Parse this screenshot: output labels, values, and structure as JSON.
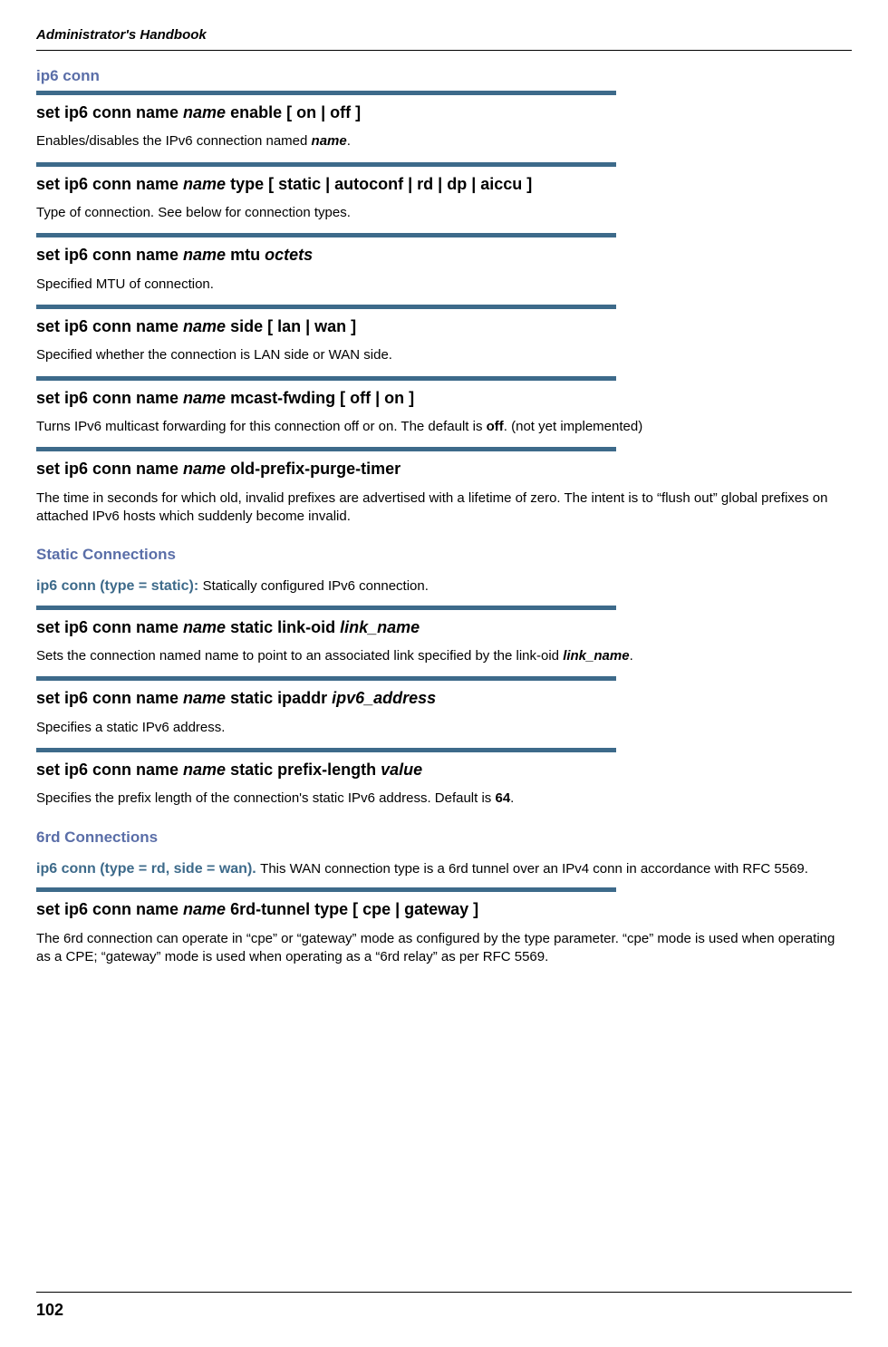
{
  "header": "Administrator's Handbook",
  "page_number": "102",
  "section1_label": "ip6 conn",
  "entries": [
    {
      "cmd_pre": "set ip6 conn name ",
      "cmd_ital": "name",
      "cmd_post": " enable [ on | off ]",
      "desc_pre": "Enables/disables the IPv6 connection named ",
      "desc_bi": "name",
      "desc_post": "."
    },
    {
      "cmd_pre": "set ip6 conn name ",
      "cmd_ital": "name",
      "cmd_post": " type [ static | autoconf | rd | dp | aiccu ]",
      "desc_pre": "Type of connection. See below for connection types.",
      "desc_bi": "",
      "desc_post": ""
    },
    {
      "cmd_pre": "set ip6 conn name ",
      "cmd_ital": "name",
      "cmd_mid": " mtu ",
      "cmd_ital2": "octets",
      "cmd_post": "",
      "desc_pre": "Specified MTU of connection.",
      "desc_bi": "",
      "desc_post": ""
    },
    {
      "cmd_pre": "set ip6 conn name ",
      "cmd_ital": "name",
      "cmd_post": " side [ lan | wan ]",
      "desc_pre": "Specified whether the connection is LAN side or WAN side.",
      "desc_bi": "",
      "desc_post": ""
    },
    {
      "cmd_pre": "set ip6 conn name ",
      "cmd_ital": "name",
      "cmd_post": " mcast-fwding [ off | on ]",
      "desc_pre": "Turns IPv6 multicast forwarding for this connection off or on. The default is ",
      "desc_b": "off",
      "desc_post": ". (not yet implemented)"
    },
    {
      "cmd_pre": "set ip6 conn name ",
      "cmd_ital": "name",
      "cmd_post": " old-prefix-purge-timer",
      "desc_pre": "The time in seconds for which old, invalid prefixes are advertised with a lifetime of zero. The intent is to “flush out” global prefixes on attached IPv6 hosts which suddenly become invalid.",
      "desc_bi": "",
      "desc_post": ""
    }
  ],
  "static_section": {
    "title": "Static Connections",
    "inline_label": "ip6 conn (type = static): ",
    "inline_desc": "Statically configured IPv6 connection.",
    "entries": [
      {
        "cmd_pre": "set ip6 conn name ",
        "cmd_ital": "name",
        "cmd_mid": " static link-oid ",
        "cmd_ital2": "link_name",
        "desc_pre": "Sets the connection named name to point to an associated link specified by the link-oid ",
        "desc_bi": "link_name",
        "desc_post": "."
      },
      {
        "cmd_pre": "set ip6 conn name ",
        "cmd_ital": "name",
        "cmd_mid": " static ipaddr ",
        "cmd_ital2": "ipv6_address",
        "desc_pre": "Specifies a static IPv6 address.",
        "desc_bi": "",
        "desc_post": ""
      },
      {
        "cmd_pre": "set ip6 conn name ",
        "cmd_ital": "name",
        "cmd_mid": " static prefix-length ",
        "cmd_ital2": "value",
        "desc_pre": "Specifies the prefix length of the connection's static IPv6 address. Default is ",
        "desc_b": "64",
        "desc_post": "."
      }
    ]
  },
  "sixrd_section": {
    "title": "6rd Connections",
    "inline_label": "ip6 conn (type = rd, side = wan). ",
    "inline_desc": "This WAN connection type is a 6rd tunnel over an IPv4 conn in accordance with RFC 5569.",
    "entries": [
      {
        "cmd_pre": "set ip6 conn name ",
        "cmd_ital": "name",
        "cmd_post": " 6rd-tunnel type [ cpe | gateway ]",
        "desc_pre": "The 6rd connection can operate in “cpe” or “gateway” mode as configured by the type parameter. “cpe” mode is used when operating as a CPE; “gateway” mode is used when operating as a “6rd relay” as per RFC 5569.",
        "desc_bi": "",
        "desc_post": ""
      }
    ]
  }
}
